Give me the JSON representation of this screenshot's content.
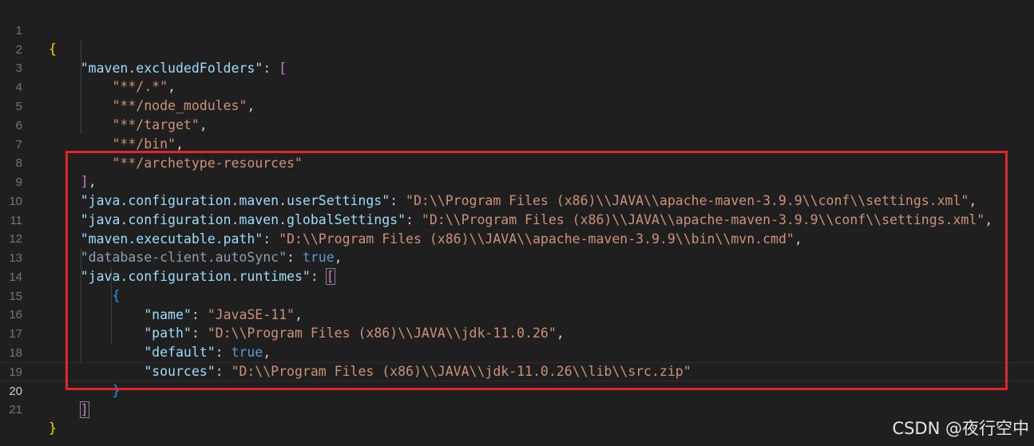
{
  "editor": {
    "line_numbers": [
      "1",
      "2",
      "3",
      "4",
      "5",
      "6",
      "7",
      "8",
      "9",
      "10",
      "11",
      "12",
      "13",
      "14",
      "15",
      "16",
      "17",
      "18",
      "19",
      "20",
      "21"
    ],
    "current_line": "20",
    "lines": {
      "l1": {
        "open_brace": "{"
      },
      "l2": {
        "key": "\"maven.excludedFolders\"",
        "colon": ": ",
        "open": "["
      },
      "l3": {
        "value": "\"**/.*\"",
        "comma": ","
      },
      "l4": {
        "value": "\"**/node_modules\"",
        "comma": ","
      },
      "l5": {
        "value": "\"**/target\"",
        "comma": ","
      },
      "l6": {
        "value": "\"**/bin\"",
        "comma": ","
      },
      "l7": {
        "value": "\"**/archetype-resources\""
      },
      "l8": {
        "close": "]",
        "comma": ","
      },
      "l9": {
        "key": "\"java.configuration.maven.userSettings\"",
        "colon": ": ",
        "value": "\"D:\\\\Program Files (x86)\\\\JAVA\\\\apache-maven-3.9.9\\\\conf\\\\settings.xml\"",
        "comma": ","
      },
      "l10": {
        "key": "\"java.configuration.maven.globalSettings\"",
        "colon": ": ",
        "value": "\"D:\\\\Program Files (x86)\\\\JAVA\\\\apache-maven-3.9.9\\\\conf\\\\settings.xml\"",
        "comma": ","
      },
      "l11": {
        "key": "\"maven.executable.path\"",
        "colon": ": ",
        "value": "\"D:\\\\Program Files (x86)\\\\JAVA\\\\apache-maven-3.9.9\\\\bin\\\\mvn.cmd\"",
        "comma": ","
      },
      "l12": {
        "key": "\"database-client.autoSync\"",
        "colon": ": ",
        "value": "true",
        "comma": ","
      },
      "l13": {
        "key": "\"java.configuration.runtimes\"",
        "colon": ": ",
        "open": "["
      },
      "l14": {
        "open": "{"
      },
      "l15": {
        "key": "\"name\"",
        "colon": ": ",
        "value": "\"JavaSE-11\"",
        "comma": ","
      },
      "l16": {
        "key": "\"path\"",
        "colon": ": ",
        "value": "\"D:\\\\Program Files (x86)\\\\JAVA\\\\jdk-11.0.26\"",
        "comma": ","
      },
      "l17": {
        "key": "\"default\"",
        "colon": ": ",
        "value": "true",
        "comma": ","
      },
      "l18": {
        "key": "\"sources\"",
        "colon": ": ",
        "value": "\"D:\\\\Program Files (x86)\\\\JAVA\\\\jdk-11.0.26\\\\lib\\\\src.zip\""
      },
      "l19": {
        "close": "}"
      },
      "l20": {
        "close": "]"
      },
      "l21": {
        "close_brace": "}"
      }
    }
  },
  "annotation": {
    "color": "#e3242b"
  },
  "watermark": "CSDN @夜行空中",
  "colors": {
    "background": "#1f1f1f",
    "key": "#9cdcfe",
    "string": "#ce9178",
    "boolean": "#569cd6",
    "bracket_level1": "#ffd700",
    "bracket_level2": "#da70d6",
    "bracket_level3": "#179fff"
  }
}
